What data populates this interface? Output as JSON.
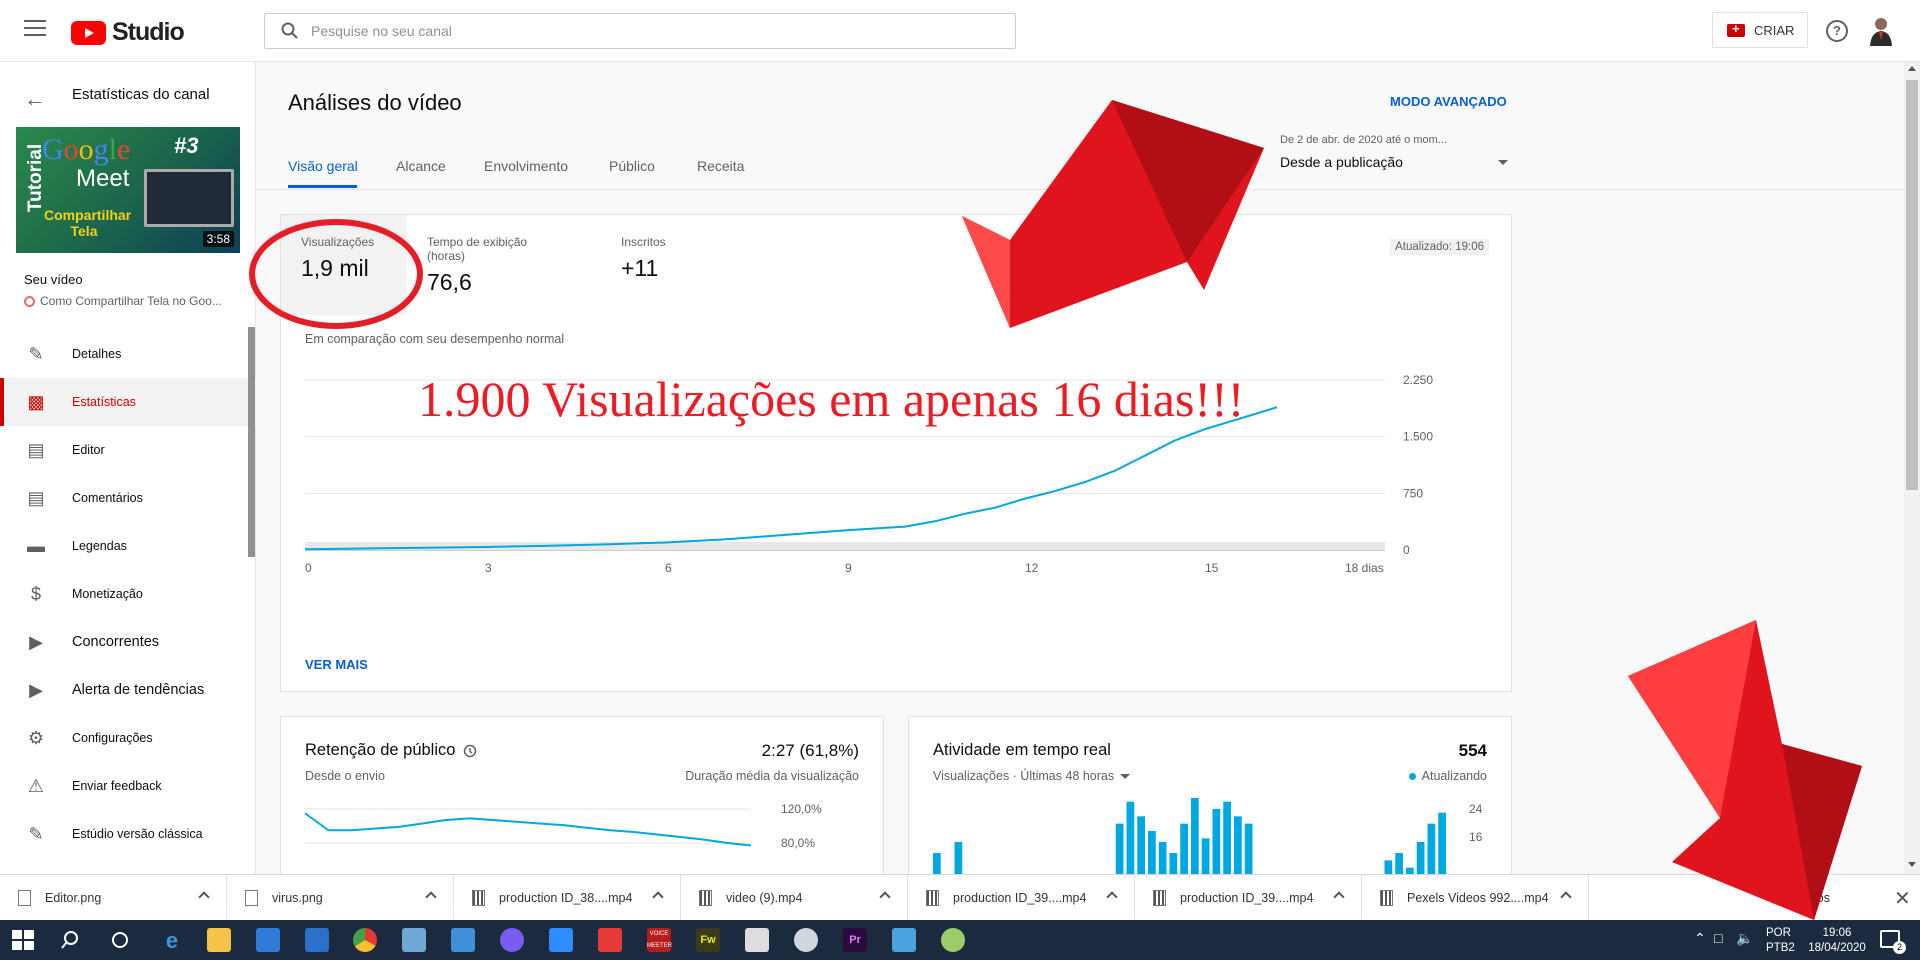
{
  "colors": {
    "accent": "#065fd4",
    "active": "#cc0000",
    "line": "#00a8e1",
    "annotation": "#ec1c24"
  },
  "header": {
    "logo_text": "Studio",
    "search_placeholder": "Pesquise no seu canal",
    "create_label": "CRIAR",
    "help_icon": "help-circle-icon"
  },
  "sidebar": {
    "title": "Estatísticas do canal",
    "thumbnail": {
      "vertical": "Tutorial",
      "brand": "Google",
      "product": "Meet",
      "number": "#3",
      "caption": "Compartilhar Tela",
      "duration": "3:58"
    },
    "your_video_label": "Seu vídeo",
    "video_title": "Como Compartilhar Tela no Goo...",
    "items": [
      {
        "label": "Detalhes",
        "icon": "pencil-icon"
      },
      {
        "label": "Estatísticas",
        "icon": "analytics-icon",
        "active": true
      },
      {
        "label": "Editor",
        "icon": "clapper-icon"
      },
      {
        "label": "Comentários",
        "icon": "comment-icon"
      },
      {
        "label": "Legendas",
        "icon": "subtitles-icon"
      },
      {
        "label": "Monetização",
        "icon": "dollar-icon"
      },
      {
        "label": "Concorrentes",
        "icon": "plugin-icon"
      },
      {
        "label": "Alerta de tendências",
        "icon": "plugin-icon"
      },
      {
        "label": "Configurações",
        "icon": "gear-icon"
      },
      {
        "label": "Enviar feedback",
        "icon": "feedback-icon"
      },
      {
        "label": "Estúdio versão clássica",
        "icon": "classic-icon"
      }
    ]
  },
  "main": {
    "title": "Análises do vídeo",
    "advanced_mode": "MODO AVANÇADO",
    "tabs": [
      "Visão geral",
      "Alcance",
      "Envolvimento",
      "Público",
      "Receita"
    ],
    "date_range": {
      "sub": "De 2 de abr. de 2020 até o mom...",
      "main": "Desde a publicação"
    },
    "metrics": [
      {
        "label": "Visualizações",
        "value": "1,9 mil"
      },
      {
        "label": "Tempo de exibição (horas)",
        "value": "76,6"
      },
      {
        "label": "Inscritos",
        "value": "+11"
      }
    ],
    "updated": "Atualizado: 19:06",
    "comparison": "Em comparação com seu desempenho normal",
    "see_more": "VER MAIS",
    "annotation": "1.900 Visualizações em apenas 16 dias!!!"
  },
  "chart_data": [
    {
      "type": "line",
      "x": [
        0,
        1,
        2,
        3,
        4,
        5,
        6,
        7,
        8,
        9,
        10,
        10.5,
        11,
        11.5,
        12,
        12.5,
        13,
        13.5,
        14,
        14.5,
        15,
        15.5,
        16.2
      ],
      "series": [
        {
          "values": [
            10,
            20,
            30,
            40,
            55,
            75,
            100,
            140,
            200,
            260,
            310,
            380,
            480,
            560,
            680,
            780,
            900,
            1050,
            1250,
            1450,
            1600,
            1720,
            1890
          ]
        }
      ],
      "x_ticks": [
        "0",
        "3",
        "6",
        "9",
        "12",
        "15",
        "18 dias"
      ],
      "y_ticks": [
        "0",
        "750",
        "1.500",
        "2.250"
      ],
      "ylim": [
        0,
        2250
      ],
      "xlim": [
        0,
        18
      ],
      "grid": true
    },
    {
      "type": "line",
      "title": "Retenção de público",
      "subtitle": "Desde o envio",
      "value": "2:27 (61,8%)",
      "value_label": "Duração média da visualização",
      "y_ticks": [
        "120,0%",
        "80,0%"
      ],
      "series": [
        {
          "values": [
            115,
            95,
            95,
            97,
            99,
            103,
            107,
            109,
            107,
            105,
            103,
            101,
            98,
            95,
            93,
            90,
            87,
            84,
            80,
            77
          ]
        }
      ]
    },
    {
      "type": "bar",
      "title": "Atividade em tempo real",
      "subtitle": "Visualizações · Últimas 48 horas",
      "value": "554",
      "value_label": "Atualizando",
      "y_ticks": [
        "24",
        "16"
      ],
      "series": [
        {
          "values": [
            12,
            0,
            15,
            0,
            0,
            0,
            0,
            0,
            0,
            0,
            0,
            0,
            0,
            0,
            0,
            3,
            6,
            20,
            26,
            22,
            18,
            15,
            12,
            20,
            27,
            16,
            24,
            26,
            22,
            20,
            0,
            0,
            0,
            0,
            0,
            0,
            0,
            0,
            0,
            0,
            0,
            0,
            10,
            12,
            8,
            15,
            20,
            23
          ]
        }
      ]
    }
  ],
  "downloads": {
    "items": [
      "Editor.png",
      "virus.png",
      "production ID_38....mp4",
      "video (9).mp4",
      "production ID_39....mp4",
      "production ID_39....mp4",
      "Pexels Videos 992....mp4"
    ],
    "show_all": "bir todos"
  },
  "taskbar": {
    "lang_1": "POR",
    "lang_2": "PTB2",
    "time": "19:06",
    "date": "18/04/2020",
    "notifications": "2",
    "voice_label": "VOICE MEETER",
    "fw_label": "Fw",
    "pr_label": "Pr"
  }
}
